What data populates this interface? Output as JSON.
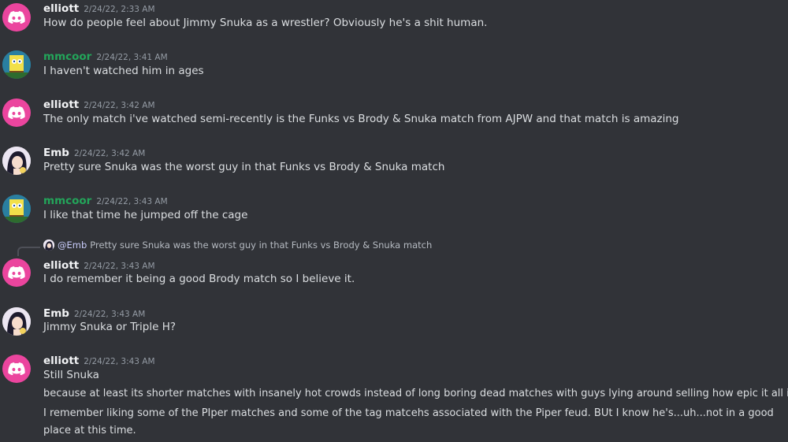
{
  "messages": [
    {
      "user": "elliott",
      "time": "2/24/22, 2:33 AM",
      "lines": [
        "How do people feel about Jimmy Snuka as a wrestler? Obviously he's a shit human."
      ]
    },
    {
      "user": "mmcoor",
      "time": "2/24/22, 3:41 AM",
      "lines": [
        "I haven't watched him in ages"
      ]
    },
    {
      "user": "elliott",
      "time": "2/24/22, 3:42 AM",
      "lines": [
        "The only match i've watched semi-recently is the Funks vs Brody & Snuka match from AJPW and that match is amazing"
      ]
    },
    {
      "user": "Emb",
      "time": "2/24/22, 3:42 AM",
      "lines": [
        "Pretty sure Snuka was the worst guy in that Funks vs Brody & Snuka match"
      ]
    },
    {
      "user": "mmcoor",
      "time": "2/24/22, 3:43 AM",
      "lines": [
        "I like that time he jumped off the cage"
      ]
    },
    {
      "user": "elliott",
      "time": "2/24/22, 3:43 AM",
      "reply": {
        "mention": "@Emb",
        "text": "Pretty sure Snuka was the worst guy in that Funks vs Brody & Snuka match"
      },
      "lines": [
        "I do remember it being a good Brody match so I believe it."
      ]
    },
    {
      "user": "Emb",
      "time": "2/24/22, 3:43 AM",
      "lines": [
        "Jimmy Snuka or Triple H?"
      ]
    },
    {
      "user": "elliott",
      "time": "2/24/22, 3:43 AM",
      "lines": [
        "Still Snuka",
        "because at least its shorter matches with insanely hot crowds instead of long boring dead matches with guys lying around selling how epic it all is",
        "I remember liking some of the PIper matches and some of the tag matcehs associated with the Piper feud. BUt I know he's...uh...not in a  good place at this time."
      ]
    }
  ],
  "icons": {
    "discord": "discord-logo-icon",
    "sponge": "spongebob-avatar-icon",
    "anime": "anime-avatar-icon"
  },
  "colors": {
    "background": "#313338",
    "discord_pink": "#eb459e",
    "mmcoor_name": "#23a55a",
    "timestamp": "#949ba4"
  }
}
